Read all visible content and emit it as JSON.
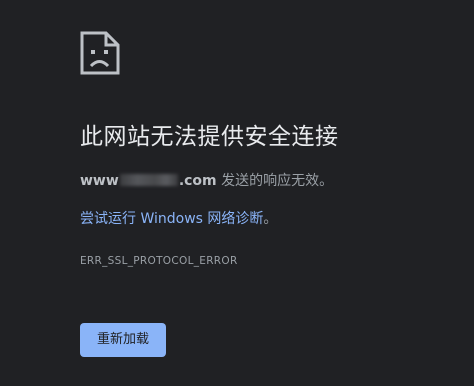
{
  "error_page": {
    "icon": "sad-page-icon",
    "title": "此网站无法提供安全连接",
    "host_prefix": "www",
    "host_suffix": ".com",
    "description_suffix": " 发送的响应无效。",
    "diagnostics_link": "尝试运行 Windows 网络诊断",
    "diagnostics_period": "。",
    "error_code": "ERR_SSL_PROTOCOL_ERROR",
    "reload_label": "重新加载"
  },
  "colors": {
    "background": "#202124",
    "title": "#e8eaed",
    "body_text": "#9aa0a6",
    "link": "#8ab4f8",
    "button_bg": "#8ab4f8",
    "button_text": "#202124"
  }
}
